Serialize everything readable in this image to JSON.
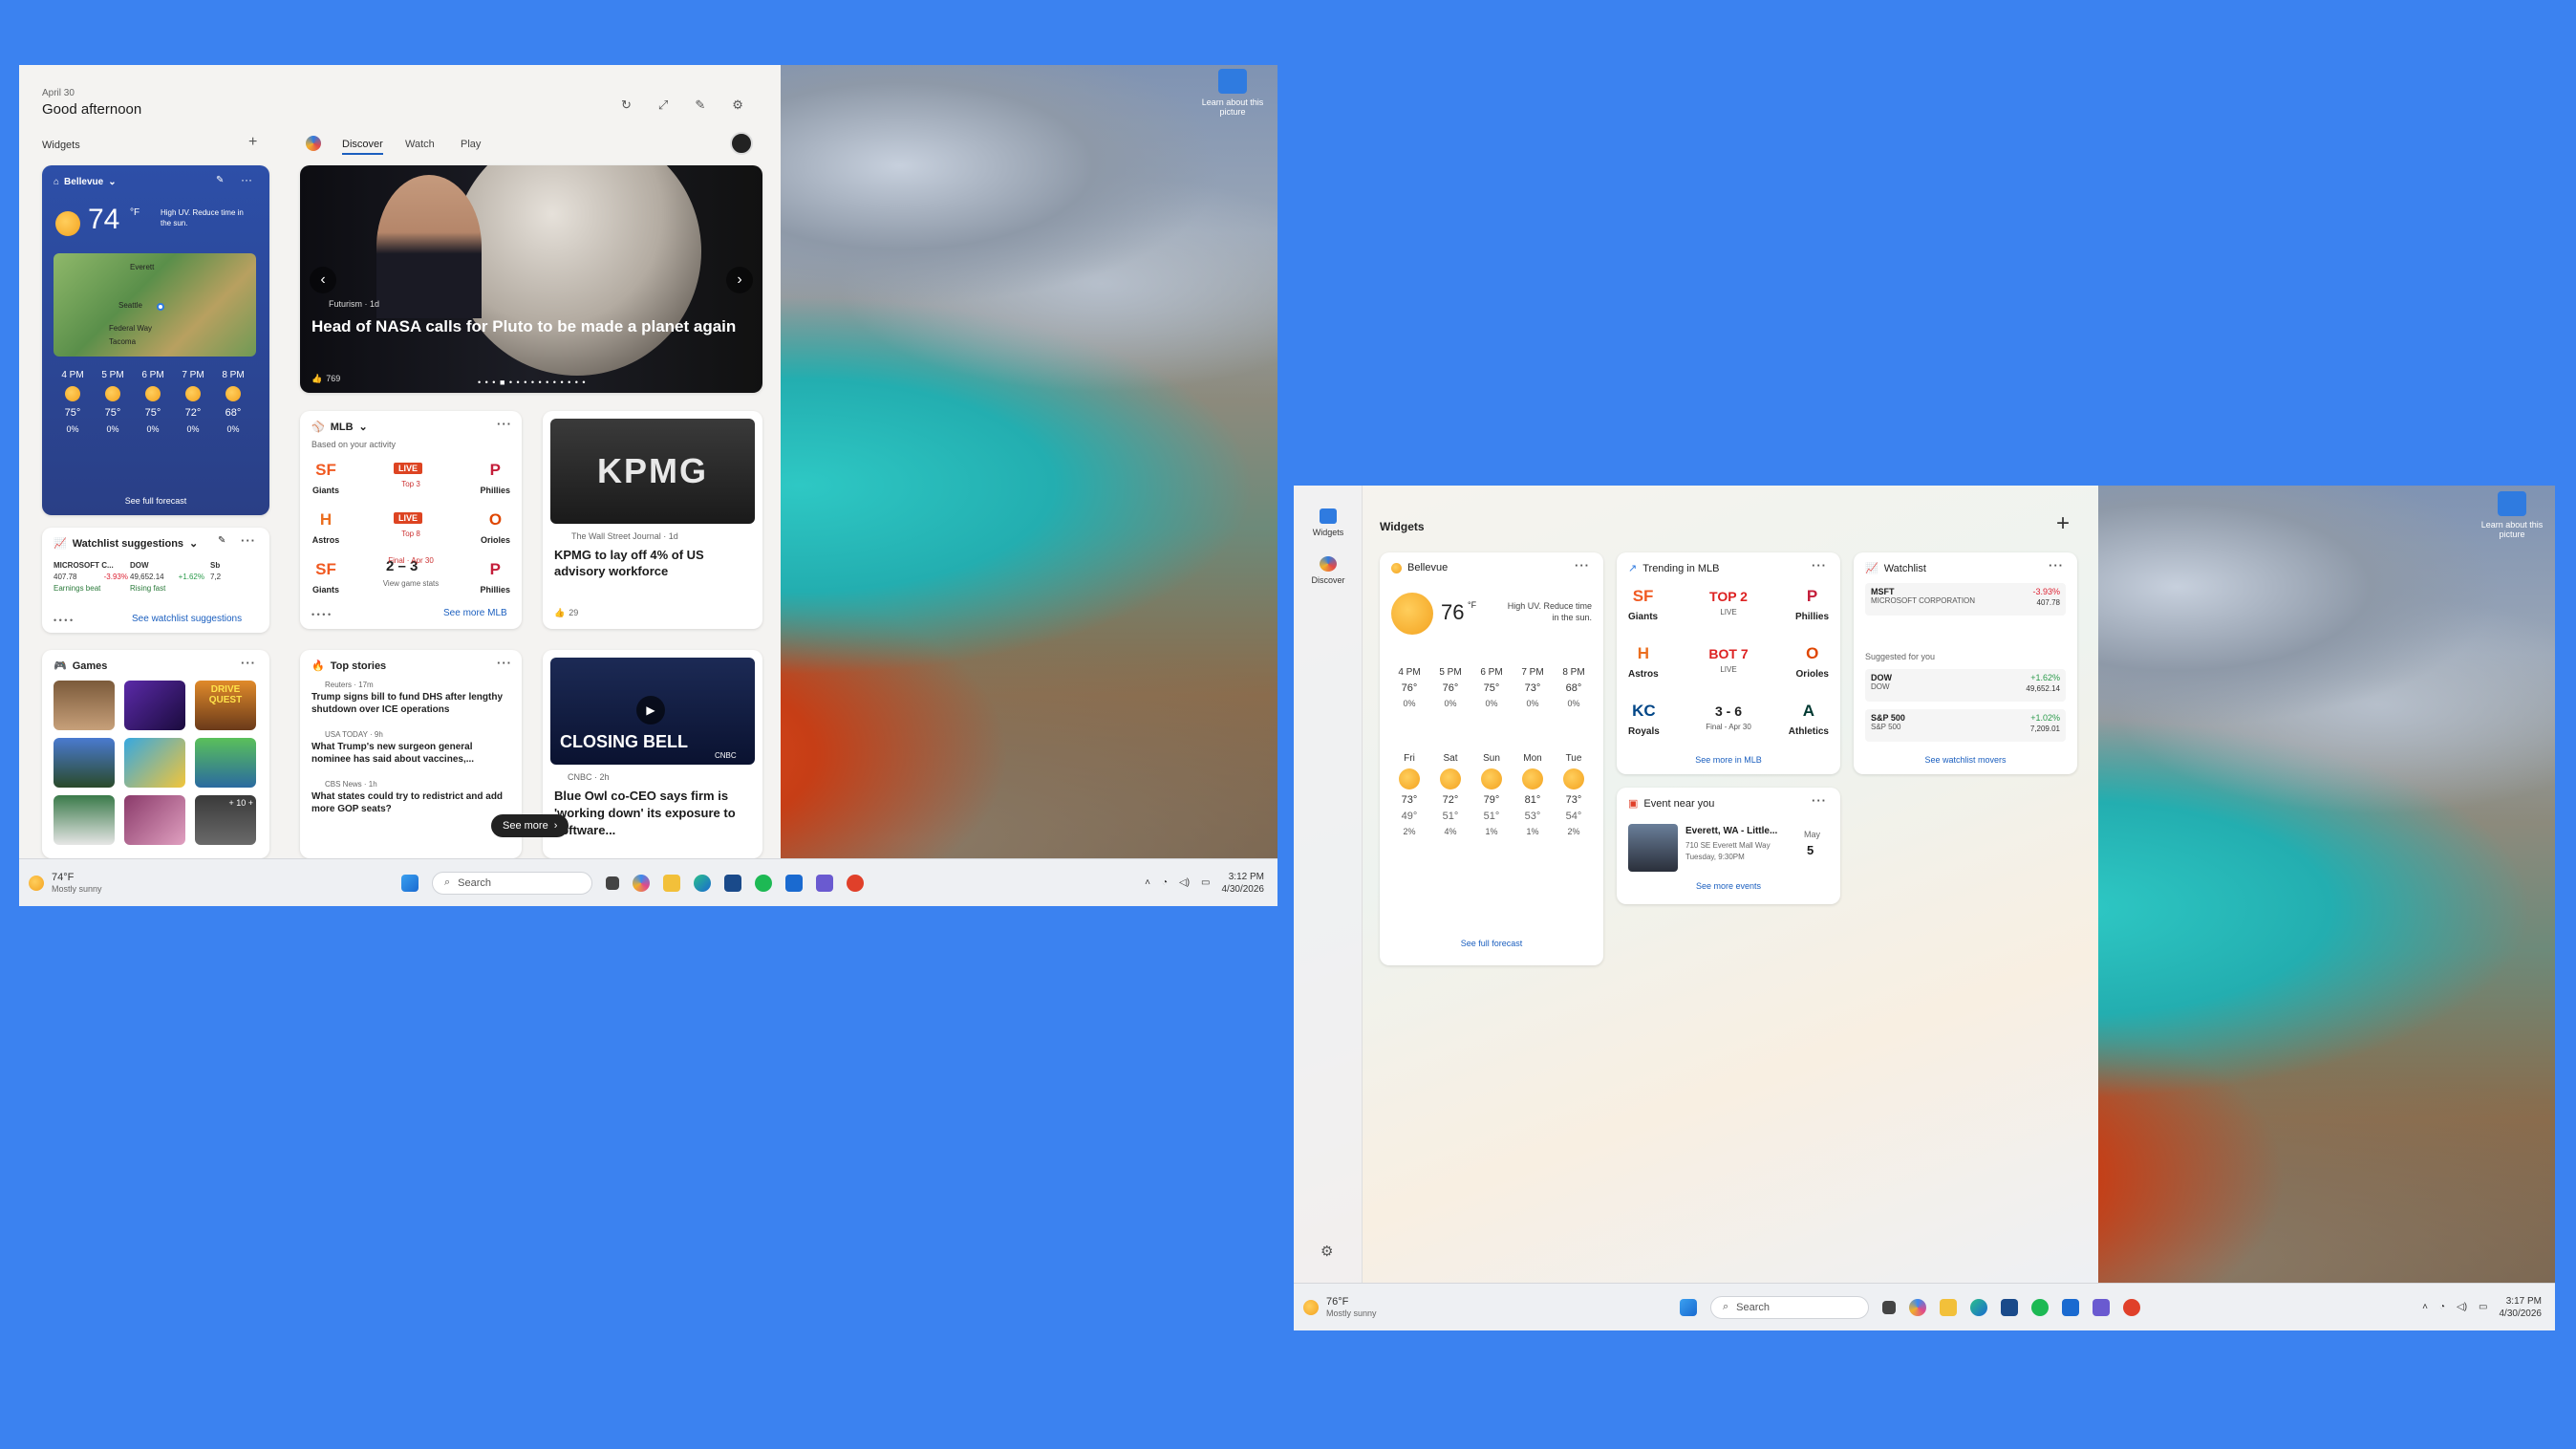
{
  "left": {
    "date": "April 30",
    "greeting": "Good afternoon",
    "widgets_label": "Widgets",
    "tabs": [
      "Discover",
      "Watch",
      "Play"
    ],
    "weather": {
      "location": "Bellevue",
      "temp": "74",
      "unit": "°F",
      "alert": "High UV. Reduce time in the sun.",
      "map_labels": [
        "Everett",
        "Seattle",
        "Federal Way",
        "Tacoma"
      ],
      "hours": [
        {
          "t": "4 PM",
          "v": "75°",
          "p": "0%"
        },
        {
          "t": "5 PM",
          "v": "75°",
          "p": "0%"
        },
        {
          "t": "6 PM",
          "v": "75°",
          "p": "0%"
        },
        {
          "t": "7 PM",
          "v": "72°",
          "p": "0%"
        },
        {
          "t": "8 PM",
          "v": "68°",
          "p": "0%"
        }
      ],
      "link": "See full forecast"
    },
    "hero": {
      "source": "Futurism · 1d",
      "title": "Head of NASA calls for Pluto to be made a planet again",
      "likes": "769"
    },
    "mlb": {
      "title": "MLB",
      "sub": "Based on your activity",
      "live": "LIVE",
      "games": [
        {
          "a": "Giants",
          "b": "Phillies",
          "mid": "LIVE",
          "status": "Top 3"
        },
        {
          "a": "Astros",
          "b": "Orioles",
          "mid": "LIVE",
          "status": "Top 8"
        },
        {
          "a": "Giants",
          "b": "Phillies",
          "mid": "2 – 3",
          "status": "Final · Apr 30",
          "extra": "View game stats"
        }
      ],
      "link": "See more MLB"
    },
    "kpmg": {
      "source": "The Wall Street Journal · 1d",
      "title": "KPMG to lay off 4% of US advisory workforce",
      "likes": "29",
      "logo": "KPMG"
    },
    "watchlist": {
      "title": "Watchlist suggestions",
      "items": [
        {
          "n": "MICROSOFT C...",
          "v": "407.78",
          "c": "-3.93%",
          "tag": "Earnings beat"
        },
        {
          "n": "DOW",
          "v": "49,652.14",
          "c": "+1.62%",
          "tag": "Rising fast"
        },
        {
          "n": "Sb",
          "v": "7,2",
          "c": "",
          "tag": ""
        }
      ],
      "link": "See watchlist suggestions"
    },
    "top": {
      "title": "Top stories",
      "items": [
        {
          "s": "Reuters · 17m",
          "t": "Trump signs bill to fund DHS after lengthy shutdown over ICE operations"
        },
        {
          "s": "USA TODAY · 9h",
          "t": "What Trump's new surgeon general nominee has said about vaccines,..."
        },
        {
          "s": "CBS News · 1h",
          "t": "What states could try to redistrict and add more GOP seats?"
        }
      ]
    },
    "cnbc": {
      "source": "CNBC · 2h",
      "title": "Blue Owl co-CEO says firm is 'working down' its exposure to software...",
      "banner": "CLOSING BELL",
      "network": "CNBC"
    },
    "see_more": "See more",
    "games_title": "Games",
    "game_tile_text": [
      "DRIVE QUEST",
      "+ 10 +"
    ],
    "learn": "Learn about this picture",
    "taskbar": {
      "temp": "74°F",
      "cond": "Mostly sunny",
      "search": "Search",
      "time": "3:12 PM",
      "date": "4/30/2026"
    }
  },
  "right": {
    "sidebar": [
      "Widgets",
      "Discover"
    ],
    "title": "Widgets",
    "weather": {
      "location": "Bellevue",
      "temp": "76",
      "unit": "°F",
      "alert": "High UV. Reduce time in the sun.",
      "hours": [
        {
          "t": "4 PM",
          "v": "76°",
          "p": "0%"
        },
        {
          "t": "5 PM",
          "v": "76°",
          "p": "0%"
        },
        {
          "t": "6 PM",
          "v": "75°",
          "p": "0%"
        },
        {
          "t": "7 PM",
          "v": "73°",
          "p": "0%"
        },
        {
          "t": "8 PM",
          "v": "68°",
          "p": "0%"
        }
      ],
      "days": [
        {
          "d": "Fri",
          "h": "73°",
          "l": "49°",
          "p": "2%"
        },
        {
          "d": "Sat",
          "h": "72°",
          "l": "51°",
          "p": "4%"
        },
        {
          "d": "Sun",
          "h": "79°",
          "l": "51°",
          "p": "1%"
        },
        {
          "d": "Mon",
          "h": "81°",
          "l": "53°",
          "p": "1%"
        },
        {
          "d": "Tue",
          "h": "73°",
          "l": "54°",
          "p": "2%"
        }
      ],
      "link": "See full forecast"
    },
    "mlb": {
      "title": "Trending in MLB",
      "games": [
        {
          "a": "Giants",
          "b": "Phillies",
          "mid": "TOP 2",
          "st": "LIVE"
        },
        {
          "a": "Astros",
          "b": "Orioles",
          "mid": "BOT 7",
          "st": "LIVE"
        },
        {
          "a": "Royals",
          "b": "Athletics",
          "mid": "3 - 6",
          "st": "Final - Apr 30"
        }
      ],
      "link": "See more in MLB"
    },
    "watch": {
      "title": "Watchlist",
      "items": [
        {
          "n": "MSFT",
          "f": "MICROSOFT CORPORATION",
          "c": "-3.93%",
          "v": "407.78"
        }
      ],
      "sugg": "Suggested for you",
      "sitems": [
        {
          "n": "DOW",
          "f": "DOW",
          "c": "+1.62%",
          "v": "49,652.14"
        },
        {
          "n": "S&P 500",
          "f": "S&P 500",
          "c": "+1.02%",
          "v": "7,209.01"
        }
      ],
      "link": "See watchlist movers"
    },
    "event": {
      "title": "Event near you",
      "name": "Everett, WA - Little...",
      "addr": "710 SE Everett Mall Way",
      "time": "Tuesday, 9:30PM",
      "month": "May",
      "day": "5",
      "link": "See more events"
    },
    "learn": "Learn about this picture",
    "taskbar": {
      "temp": "76°F",
      "cond": "Mostly sunny",
      "search": "Search",
      "time": "3:17 PM",
      "date": "4/30/2026"
    }
  }
}
